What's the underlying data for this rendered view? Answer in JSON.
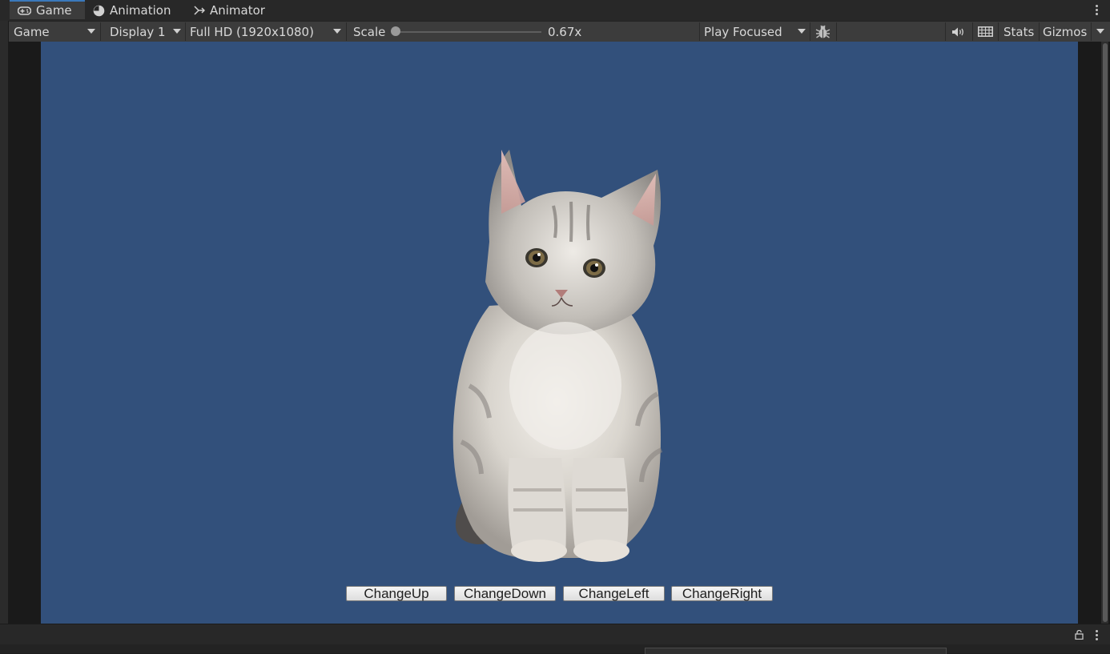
{
  "tabs": [
    {
      "label": "Game",
      "icon": "gamepad-icon",
      "active": true
    },
    {
      "label": "Animation",
      "icon": "clock-icon",
      "active": false
    },
    {
      "label": "Animator",
      "icon": "animator-icon",
      "active": false
    }
  ],
  "toolbar": {
    "view_mode": "Game",
    "display": "Display 1",
    "resolution": "Full HD (1920x1080)",
    "scale_label": "Scale",
    "scale_value": "0.67x",
    "scale_fraction": 0.0,
    "play_mode": "Play Focused",
    "stats_label": "Stats",
    "gizmos_label": "Gizmos"
  },
  "game": {
    "background_color": "#32507b",
    "buttons": [
      {
        "label": "ChangeUp"
      },
      {
        "label": "ChangeDown"
      },
      {
        "label": "ChangeLeft"
      },
      {
        "label": "ChangeRight"
      }
    ]
  },
  "colors": {
    "accent": "#3a79bb",
    "panel": "#3c3c3c",
    "tabbar": "#282828"
  }
}
